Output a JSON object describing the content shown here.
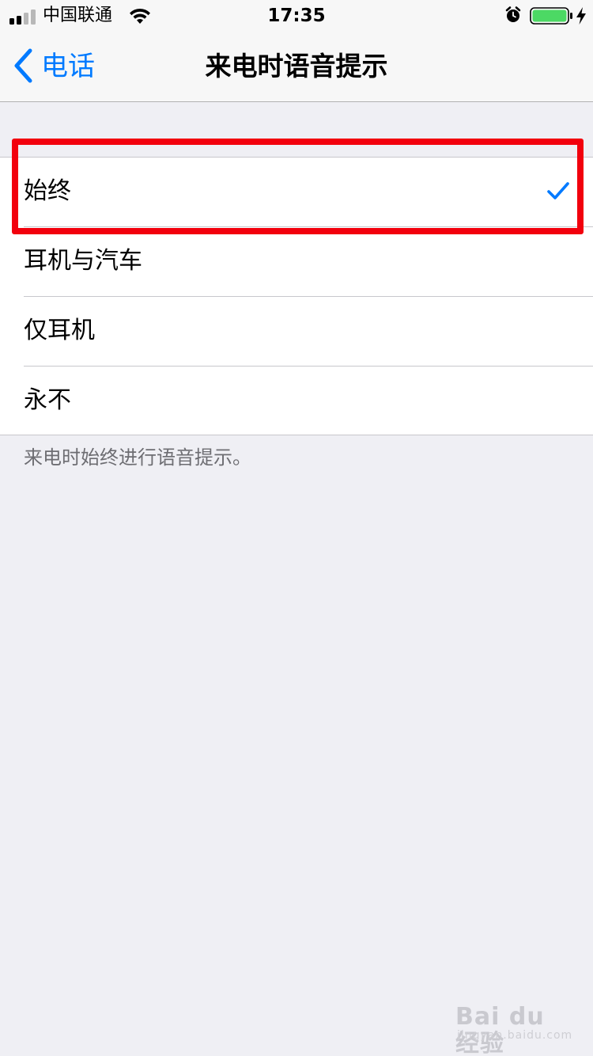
{
  "status_bar": {
    "carrier": "中国联通",
    "time": "17:35",
    "signal_bars_filled": 2,
    "signal_bars_total": 4,
    "battery_level": 1.0,
    "icons": [
      "signal-icon",
      "wifi-icon",
      "alarm-icon",
      "battery-icon",
      "charging-icon"
    ]
  },
  "nav": {
    "back_label": "电话",
    "title": "来电时语音提示"
  },
  "options": [
    {
      "label": "始终",
      "selected": true
    },
    {
      "label": "耳机与汽车",
      "selected": false
    },
    {
      "label": "仅耳机",
      "selected": false
    },
    {
      "label": "永不",
      "selected": false
    }
  ],
  "footer_note": "来电时始终进行语音提示。",
  "watermark": {
    "brand": "Bai du经验",
    "url": "jingyan.baidu.com"
  },
  "colors": {
    "accent": "#007aff",
    "highlight": "#f2000d",
    "background": "#efeff4",
    "battery": "#4cd964"
  }
}
